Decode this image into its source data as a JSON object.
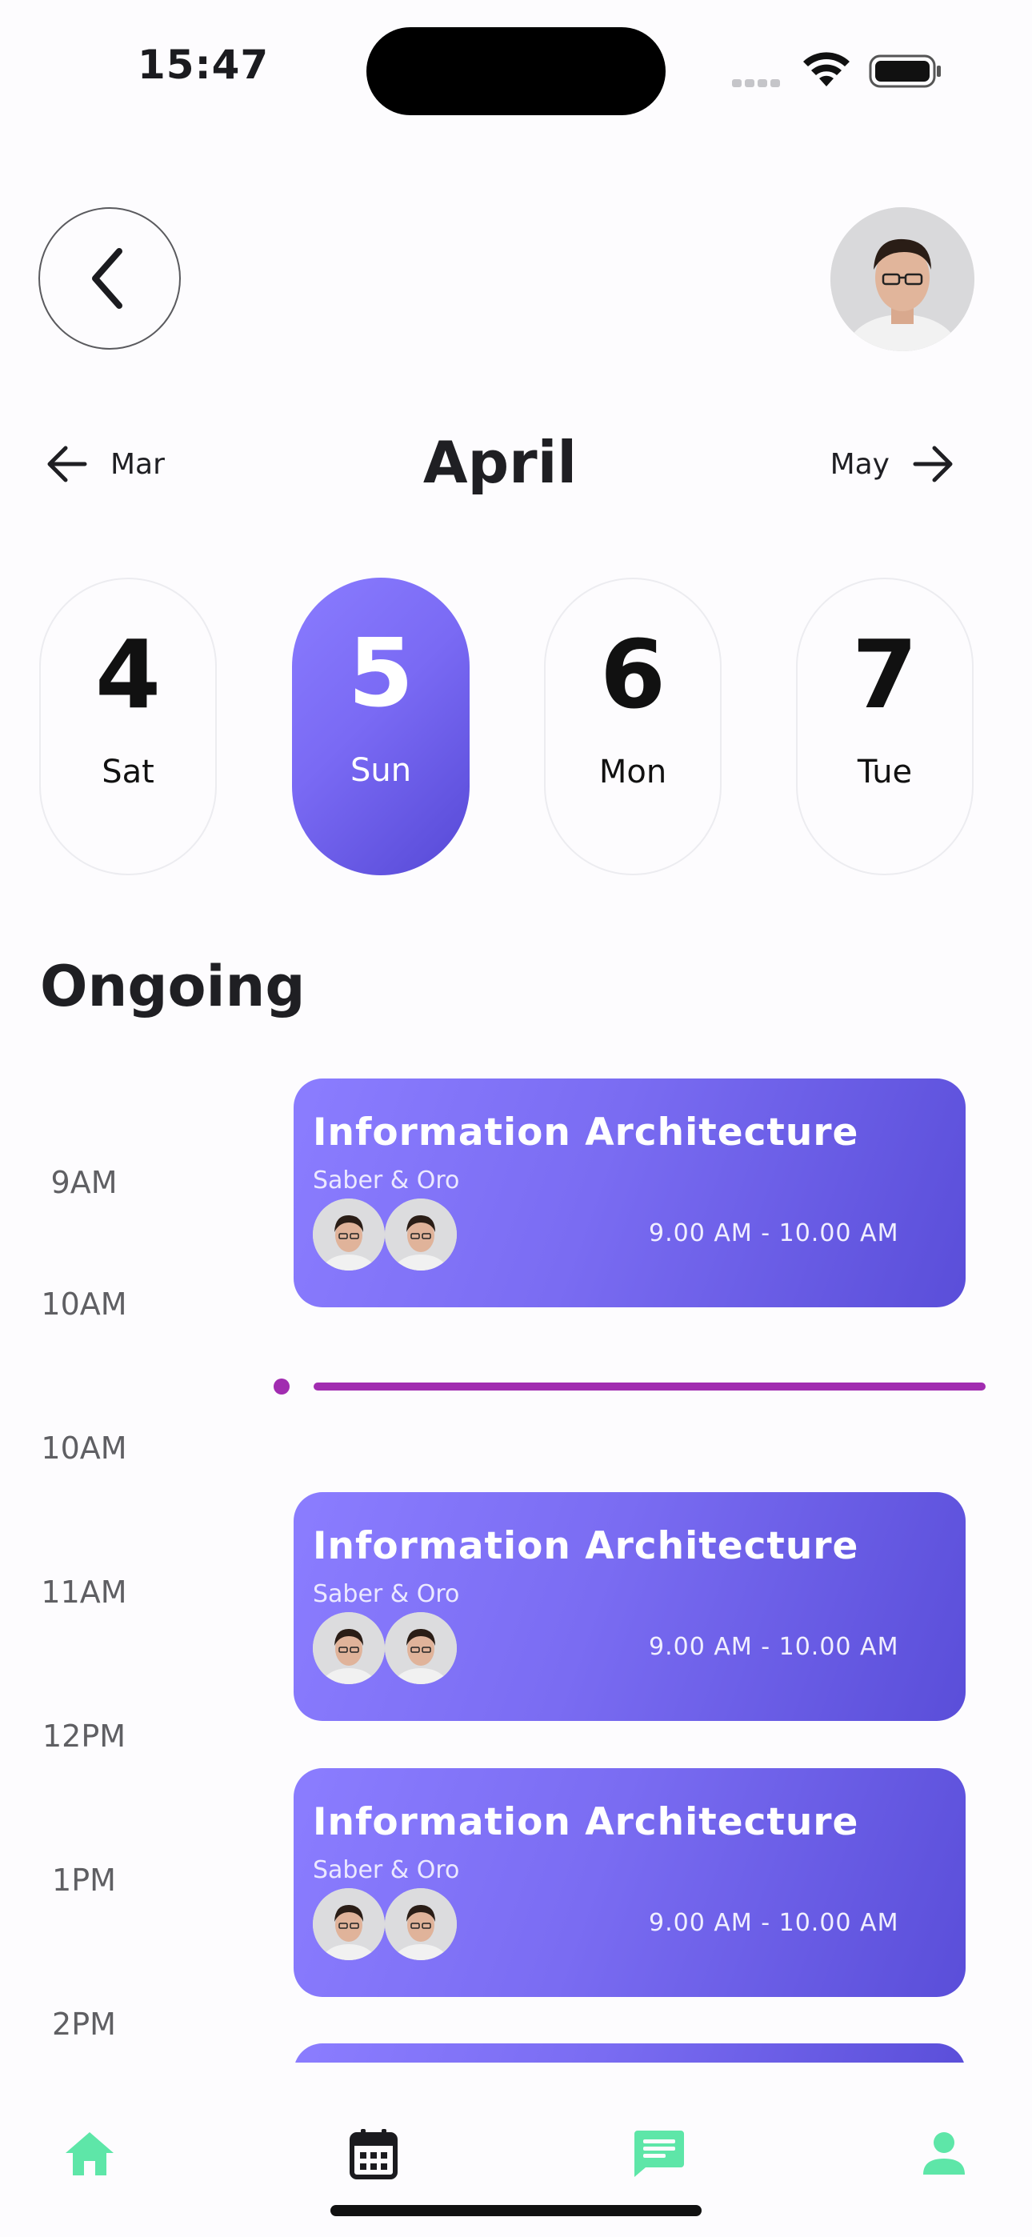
{
  "status_bar": {
    "time": "15:47"
  },
  "header": {
    "back_icon": "chevron-left-icon",
    "avatar": "profile-avatar"
  },
  "month_nav": {
    "prev": "Mar",
    "current": "April",
    "next": "May"
  },
  "days": [
    {
      "num": "4",
      "weekday": "Sat",
      "selected": false
    },
    {
      "num": "5",
      "weekday": "Sun",
      "selected": true
    },
    {
      "num": "6",
      "weekday": "Mon",
      "selected": false
    },
    {
      "num": "7",
      "weekday": "Tue",
      "selected": false
    }
  ],
  "section": {
    "title": "Ongoing"
  },
  "time_labels": [
    "9AM",
    "10AM",
    "10AM",
    "11AM",
    "12PM",
    "1PM",
    "2PM"
  ],
  "events": [
    {
      "title": "Information Architecture",
      "subtitle": "Saber & Oro",
      "time": "9.00 AM - 10.00 AM"
    },
    {
      "title": "Information Architecture",
      "subtitle": "Saber & Oro",
      "time": "9.00 AM - 10.00 AM"
    },
    {
      "title": "Information Architecture",
      "subtitle": "Saber & Oro",
      "time": "9.00 AM - 10.00 AM"
    }
  ],
  "bottom_nav": {
    "items": [
      "home-icon",
      "calendar-icon",
      "chat-icon",
      "profile-icon"
    ],
    "accent_color": "#5ee6a8"
  },
  "colors": {
    "primary_gradient_start": "#8b7dff",
    "primary_gradient_end": "#5a4ed9",
    "now_line": "#a12cb0"
  }
}
